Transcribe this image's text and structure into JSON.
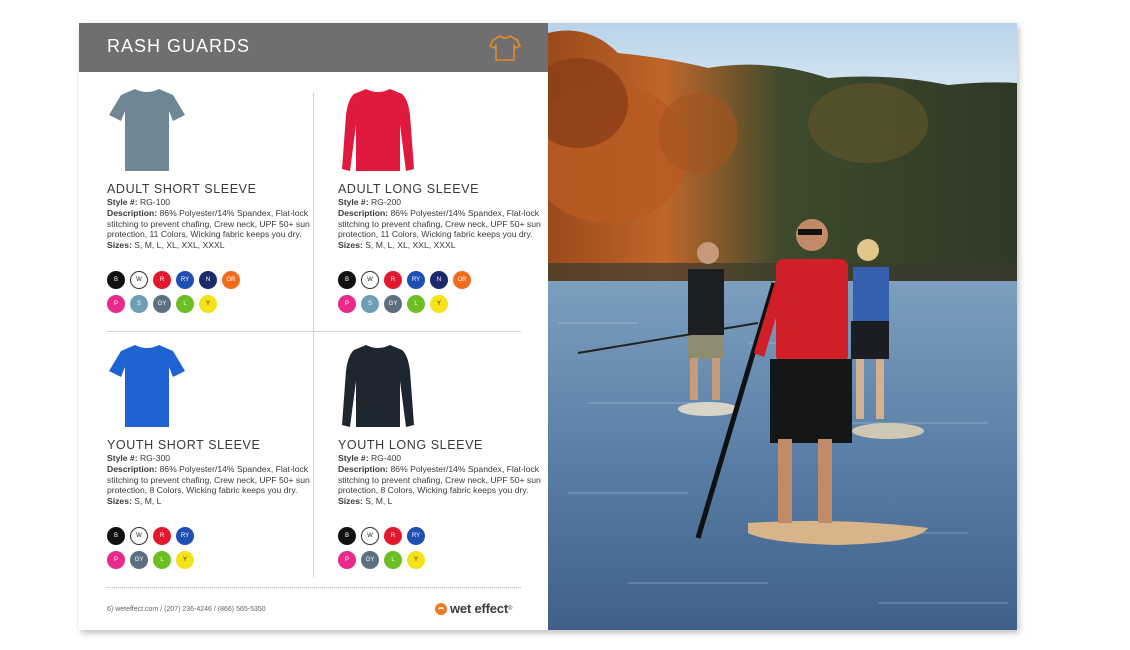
{
  "header": {
    "title": "RASH GUARDS",
    "icon": "shirt-outline-icon",
    "accent": "#e58a2c",
    "bg": "#6f6f70"
  },
  "products": [
    {
      "name": "ADULT SHORT SLEEVE",
      "style_label": "Style #:",
      "style_value": "RG-100",
      "desc_label": "Description:",
      "desc_value": "86% Polyester/14% Spandex, Flat-lock stitching to prevent chafing, Crew neck, UPF 50+ sun protection, 11 Colors, Wicking fabric keeps you dry.",
      "sizes_label": "Sizes:",
      "sizes_value": "S, M, L, XL, XXL, XXXL",
      "shirt_color": "#6f8795",
      "sleeve": "short",
      "swatch_rows": [
        [
          {
            "code": "B",
            "color": "#111111"
          },
          {
            "code": "W",
            "color": "#ffffff"
          },
          {
            "code": "R",
            "color": "#e3182d"
          },
          {
            "code": "RY",
            "color": "#1f4fb5"
          },
          {
            "code": "N",
            "color": "#1b2a6b"
          },
          {
            "code": "OR",
            "color": "#f26b1d"
          }
        ],
        [
          {
            "code": "P",
            "color": "#ea2a8a"
          },
          {
            "code": "S",
            "color": "#6e9db8"
          },
          {
            "code": "GY",
            "color": "#5c6f80"
          },
          {
            "code": "L",
            "color": "#6cc024"
          },
          {
            "code": "Y",
            "color": "#f4e21b"
          }
        ]
      ]
    },
    {
      "name": "ADULT LONG SLEEVE",
      "style_label": "Style #:",
      "style_value": "RG-200",
      "desc_label": "Description:",
      "desc_value": "86% Polyester/14% Spandex, Flat-lock stitching to prevent chafing, Crew neck, UPF 50+ sun protection, 11 Colors, Wicking fabric keeps you dry.",
      "sizes_label": "Sizes:",
      "sizes_value": "S, M, L, XL, XXL, XXXL",
      "shirt_color": "#e0193f",
      "sleeve": "long",
      "swatch_rows": [
        [
          {
            "code": "B",
            "color": "#111111"
          },
          {
            "code": "W",
            "color": "#ffffff"
          },
          {
            "code": "R",
            "color": "#e3182d"
          },
          {
            "code": "RY",
            "color": "#1f4fb5"
          },
          {
            "code": "N",
            "color": "#1b2a6b"
          },
          {
            "code": "OR",
            "color": "#f26b1d"
          }
        ],
        [
          {
            "code": "P",
            "color": "#ea2a8a"
          },
          {
            "code": "S",
            "color": "#6e9db8"
          },
          {
            "code": "GY",
            "color": "#5c6f80"
          },
          {
            "code": "L",
            "color": "#6cc024"
          },
          {
            "code": "Y",
            "color": "#f4e21b"
          }
        ]
      ]
    },
    {
      "name": "YOUTH SHORT SLEEVE",
      "style_label": "Style #:",
      "style_value": "RG-300",
      "desc_label": "Description:",
      "desc_value": "86% Polyester/14% Spandex, Flat-lock stitching to prevent chafing, Crew neck, UPF 50+ sun protection, 8 Colors, Wicking fabric keeps you dry.",
      "sizes_label": "Sizes:",
      "sizes_value": "S, M, L",
      "shirt_color": "#1f63d2",
      "sleeve": "short",
      "swatch_rows": [
        [
          {
            "code": "B",
            "color": "#111111"
          },
          {
            "code": "W",
            "color": "#ffffff"
          },
          {
            "code": "R",
            "color": "#e3182d"
          },
          {
            "code": "RY",
            "color": "#1f4fb5"
          }
        ],
        [
          {
            "code": "P",
            "color": "#ea2a8a"
          },
          {
            "code": "GY",
            "color": "#5c6f80"
          },
          {
            "code": "L",
            "color": "#6cc024"
          },
          {
            "code": "Y",
            "color": "#f4e21b"
          }
        ]
      ]
    },
    {
      "name": "YOUTH LONG SLEEVE",
      "style_label": "Style #:",
      "style_value": "RG-400",
      "desc_label": "Description:",
      "desc_value": "86% Polyester/14% Spandex, Flat-lock stitching to prevent chafing, Crew neck, UPF 50+ sun protection, 8 Colors, Wicking fabric keeps you dry.",
      "sizes_label": "Sizes:",
      "sizes_value": "S, M, L",
      "shirt_color": "#1e2630",
      "sleeve": "long",
      "swatch_rows": [
        [
          {
            "code": "B",
            "color": "#111111"
          },
          {
            "code": "W",
            "color": "#ffffff"
          },
          {
            "code": "R",
            "color": "#e3182d"
          },
          {
            "code": "RY",
            "color": "#1f4fb5"
          }
        ],
        [
          {
            "code": "P",
            "color": "#ea2a8a"
          },
          {
            "code": "GY",
            "color": "#5c6f80"
          },
          {
            "code": "L",
            "color": "#6cc024"
          },
          {
            "code": "Y",
            "color": "#f4e21b"
          }
        ]
      ]
    }
  ],
  "footer": {
    "page_number": "6",
    "contact": "weteffect.com  /  (207) 236-4246  /  (866) 565-5350",
    "logo_text": "wet effect",
    "logo_tm": "®",
    "logo_color": "#f07a22"
  },
  "photo": {
    "subject": "paddleboarders on lake with autumn trees"
  }
}
